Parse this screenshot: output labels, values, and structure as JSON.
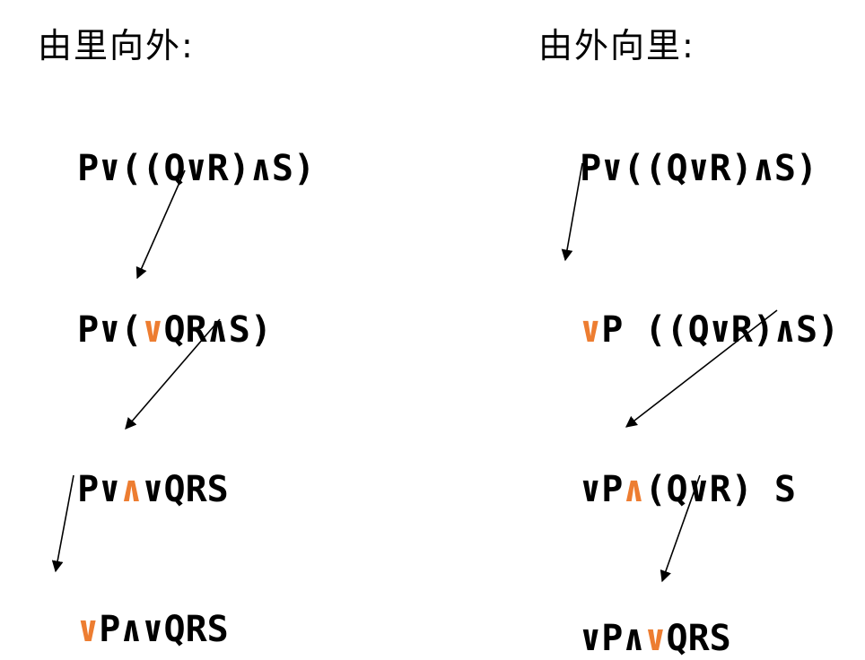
{
  "colors": {
    "highlight": "#ED7D31",
    "arrow": "#000000"
  },
  "left": {
    "heading": "由里向外:",
    "rows": [
      [
        {
          "t": "P∨((Q∨R)∧S)"
        }
      ],
      [
        {
          "t": "P∨("
        },
        {
          "t": "∨",
          "hl": true
        },
        {
          "t": "QR∧S)"
        }
      ],
      [
        {
          "t": "P∨"
        },
        {
          "t": "∧",
          "hl": true
        },
        {
          "t": "∨QRS"
        }
      ],
      [
        {
          "t": "∨",
          "hl": true
        },
        {
          "t": "P∧∨QRS"
        }
      ]
    ]
  },
  "right": {
    "heading": "由外向里:",
    "rows": [
      [
        {
          "t": "P∨((Q∨R)∧S)"
        }
      ],
      [
        {
          "t": "∨",
          "hl": true
        },
        {
          "t": "P ((Q∨R)∧S)"
        }
      ],
      [
        {
          "t": "∨P"
        },
        {
          "t": "∧",
          "hl": true
        },
        {
          "t": "(Q∨R) S"
        }
      ],
      [
        {
          "t": "∨P∧"
        },
        {
          "t": "∨",
          "hl": true
        },
        {
          "t": "QRS"
        }
      ]
    ]
  }
}
